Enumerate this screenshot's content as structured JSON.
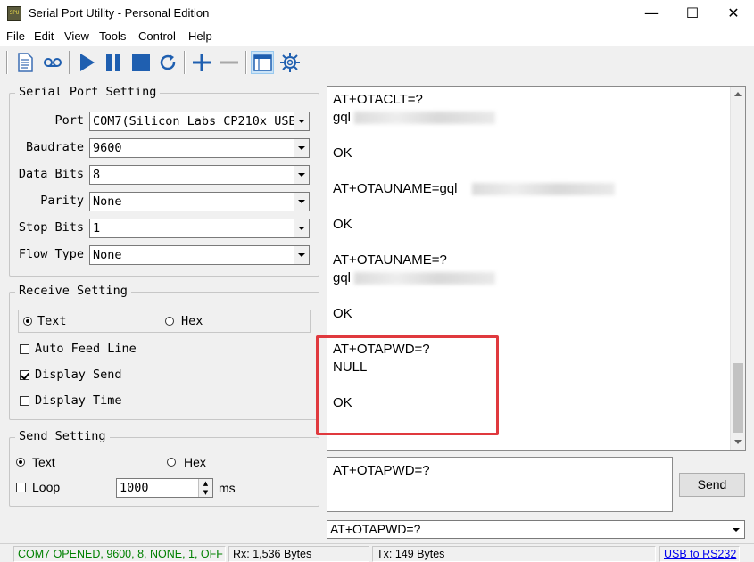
{
  "window": {
    "title": "Serial Port Utility - Personal Edition",
    "app_icon_text": "SPU"
  },
  "menu": [
    "File",
    "Edit",
    "View",
    "Tools",
    "Control",
    "Help"
  ],
  "toolbar": [
    "new-document-icon",
    "record-icon",
    "play-icon",
    "pause-icon",
    "stop-icon",
    "refresh-icon",
    "plus-icon",
    "minus-icon",
    "window-icon",
    "gear-icon"
  ],
  "serial_port_setting": {
    "title": "Serial Port Setting",
    "fields": [
      {
        "label": "Port",
        "value": "COM7(Silicon Labs CP210x USB"
      },
      {
        "label": "Baudrate",
        "value": "9600"
      },
      {
        "label": "Data Bits",
        "value": "8"
      },
      {
        "label": "Parity",
        "value": "None"
      },
      {
        "label": "Stop Bits",
        "value": "1"
      },
      {
        "label": "Flow Type",
        "value": "None"
      }
    ]
  },
  "receive_setting": {
    "title": "Receive Setting",
    "text_label": "Text",
    "hex_label": "Hex",
    "mode": "Text",
    "auto_feed_line": "Auto Feed Line",
    "display_send": "Display Send",
    "display_time": "Display Time",
    "auto_feed_checked": false,
    "display_send_checked": true,
    "display_time_checked": false
  },
  "send_setting": {
    "title": "Send Setting",
    "text_label": "Text",
    "hex_label": "Hex",
    "mode": "Text",
    "loop_label": "Loop",
    "loop_checked": false,
    "interval": "1000",
    "unit": "ms"
  },
  "receive_log": [
    "AT+OTACLT=?",
    "gql",
    "OK",
    "AT+OTAUNAME=gql",
    "OK",
    "AT+OTAUNAME=?",
    "gql",
    "OK",
    "AT+OTAPWD=?",
    "NULL",
    "OK"
  ],
  "send_input": "AT+OTAPWD=?",
  "send_button": "Send",
  "history_value": "AT+OTAPWD=?",
  "status": {
    "port": "COM7 OPENED, 9600, 8, NONE, 1, OFF",
    "rx": "Rx: 1,536 Bytes",
    "tx": "Tx: 149 Bytes",
    "link": "USB to RS232",
    "port_color": "#008000",
    "link_color": "#0000ee"
  },
  "highlight_color": "#e0393e"
}
